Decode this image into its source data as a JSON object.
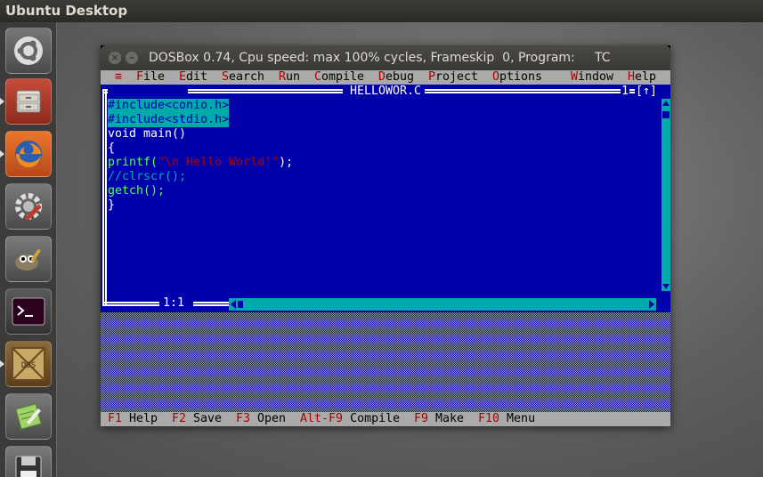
{
  "panel": {
    "title": "Ubuntu Desktop"
  },
  "launcher": {
    "items": [
      {
        "name": "ubuntu-dash-icon"
      },
      {
        "name": "file-manager-icon"
      },
      {
        "name": "firefox-icon"
      },
      {
        "name": "system-settings-icon"
      },
      {
        "name": "gimp-icon"
      },
      {
        "name": "terminal-icon"
      },
      {
        "name": "dosbox-icon",
        "label": "DOS BOX"
      },
      {
        "name": "text-editor-icon"
      },
      {
        "name": "save-disk-icon"
      }
    ]
  },
  "dosbox": {
    "close_glyph": "×",
    "min_glyph": "–",
    "title": "DOSBox 0.74, Cpu speed: max 100% cycles, Frameskip  0, Program:     TC"
  },
  "tc": {
    "menu": {
      "system": "≡",
      "items": [
        {
          "hot": "F",
          "rest": "ile"
        },
        {
          "hot": "E",
          "rest": "dit"
        },
        {
          "hot": "S",
          "rest": "earch"
        },
        {
          "hot": "R",
          "rest": "un"
        },
        {
          "hot": "C",
          "rest": "ompile"
        },
        {
          "hot": "D",
          "rest": "ebug"
        },
        {
          "hot": "P",
          "rest": "roject"
        },
        {
          "hot": "O",
          "rest": "ptions"
        },
        {
          "hot": "W",
          "rest": "indow"
        },
        {
          "hot": "H",
          "rest": "elp"
        }
      ]
    },
    "editor": {
      "close_box": "[■]",
      "filename": "HELLOWOR.C",
      "window_number": "1",
      "zoom_box": "[↑]",
      "cursor_pos": "1:1",
      "lines": {
        "l1": "#include<conio.h>",
        "l2": "#include<stdio.h>",
        "l3": "void main()",
        "l4": "{",
        "l5a": "printf(",
        "l5b": "\"\\n Hello World!\"",
        "l5c": ");",
        "l6": "//clrscr();",
        "l7": "getch();",
        "l8": "}"
      }
    },
    "status": [
      {
        "key": "F1",
        "label": "Help"
      },
      {
        "key": "F2",
        "label": "Save"
      },
      {
        "key": "F3",
        "label": "Open"
      },
      {
        "key": "Alt-F9",
        "label": "Compile"
      },
      {
        "key": "F9",
        "label": "Make"
      },
      {
        "key": "F10",
        "label": "Menu"
      }
    ]
  }
}
